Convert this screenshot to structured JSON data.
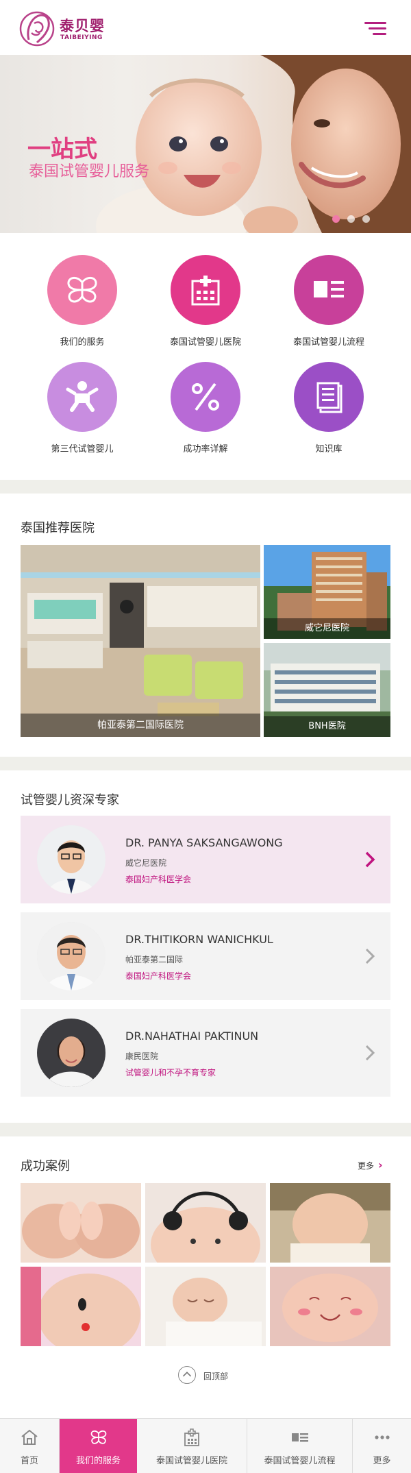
{
  "header": {
    "brand_cn": "泰贝婴",
    "brand_en": "TAIBEIYING"
  },
  "banner": {
    "headline": "一站式",
    "subheadline": "泰国试管婴儿服务",
    "slide_count": 3,
    "active_slide": 1
  },
  "services": [
    {
      "label": "我们的服务",
      "icon": "butterfly-icon",
      "color": "#f07aa8"
    },
    {
      "label": "泰国试管婴儿医院",
      "icon": "hospital-icon",
      "color": "#e2388a"
    },
    {
      "label": "泰国试管婴儿流程",
      "icon": "process-list-icon",
      "color": "#c8409a"
    },
    {
      "label": "第三代试管婴儿",
      "icon": "baby-icon",
      "color": "#c88de0"
    },
    {
      "label": "成功率详解",
      "icon": "percent-icon",
      "color": "#b86ad6"
    },
    {
      "label": "知识库",
      "icon": "book-icon",
      "color": "#9b4fc6"
    }
  ],
  "hospitals": {
    "title": "泰国推荐医院",
    "items": [
      {
        "name": "帕亚泰第二国际医院"
      },
      {
        "name": "威它尼医院"
      },
      {
        "name": "BNH医院"
      }
    ]
  },
  "experts": {
    "title": "试管婴儿资深专家",
    "items": [
      {
        "name": "DR. PANYA SAKSANGAWONG",
        "hospital": "威它尼医院",
        "tag": "泰国妇产科医学会"
      },
      {
        "name": "DR.THITIKORN WANICHKUL",
        "hospital": "帕亚泰第二国际",
        "tag": "泰国妇产科医学会"
      },
      {
        "name": "DR.NAHATHAI PAKTINUN",
        "hospital": "康民医院",
        "tag": "试管婴儿和不孕不育专家"
      }
    ]
  },
  "cases": {
    "title": "成功案例",
    "more": "更多",
    "count": 6
  },
  "back_to_top": "回顶部",
  "bottom_nav": [
    {
      "label": "首页",
      "icon": "home-icon"
    },
    {
      "label": "我们的服务",
      "icon": "butterfly-icon"
    },
    {
      "label": "泰国试管婴儿医院",
      "icon": "hospital-icon"
    },
    {
      "label": "泰国试管婴儿流程",
      "icon": "process-list-icon"
    },
    {
      "label": "更多",
      "icon": "more-dots-icon"
    }
  ],
  "colors": {
    "brand": "#a0206e",
    "accent": "#e2388a",
    "tag": "#c0147f"
  }
}
